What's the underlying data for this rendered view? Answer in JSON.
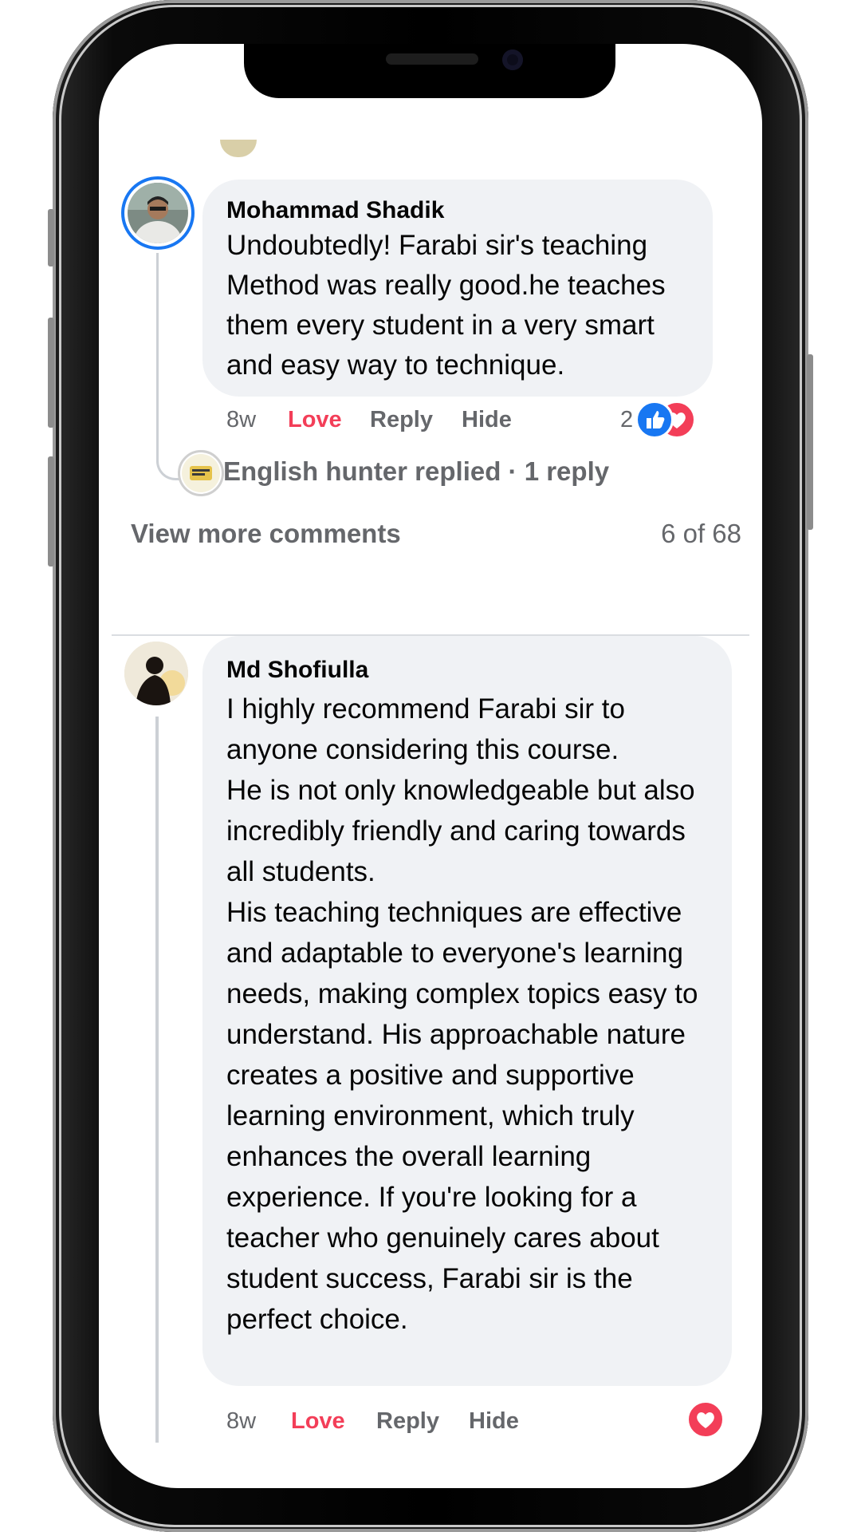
{
  "comments": [
    {
      "author": "Mohammad Shadik",
      "text": "Undoubtedly! Farabi sir's teaching Method was really good.he teaches them every student in a very smart and easy way to technique.",
      "time": "8w",
      "reaction_label": "Love",
      "reply_label": "Reply",
      "hide_label": "Hide",
      "reaction_count": "2",
      "reply_summary": "English hunter replied · 1 reply"
    },
    {
      "author": "Md Shofiulla",
      "text": "I highly recommend Farabi sir to anyone considering this course.\nHe is not only knowledgeable but also incredibly friendly and caring towards all students.\nHis teaching techniques are effective and adaptable to everyone's learning needs, making complex topics easy to understand. His approachable nature creates a positive and supportive learning environment, which truly enhances the overall learning experience. If you're looking for a teacher who genuinely cares about student success, Farabi sir is the perfect choice.",
      "time": "8w",
      "reaction_label": "Love",
      "reply_label": "Reply",
      "hide_label": "Hide"
    }
  ],
  "view_more_label": "View more comments",
  "comment_position": "6 of 68",
  "icons": {
    "like": "like-icon",
    "love": "heart-icon"
  },
  "colors": {
    "like_blue": "#1877f2",
    "love_red": "#f33e58",
    "bubble_gray": "#f0f2f5",
    "meta_gray": "#65676b"
  }
}
